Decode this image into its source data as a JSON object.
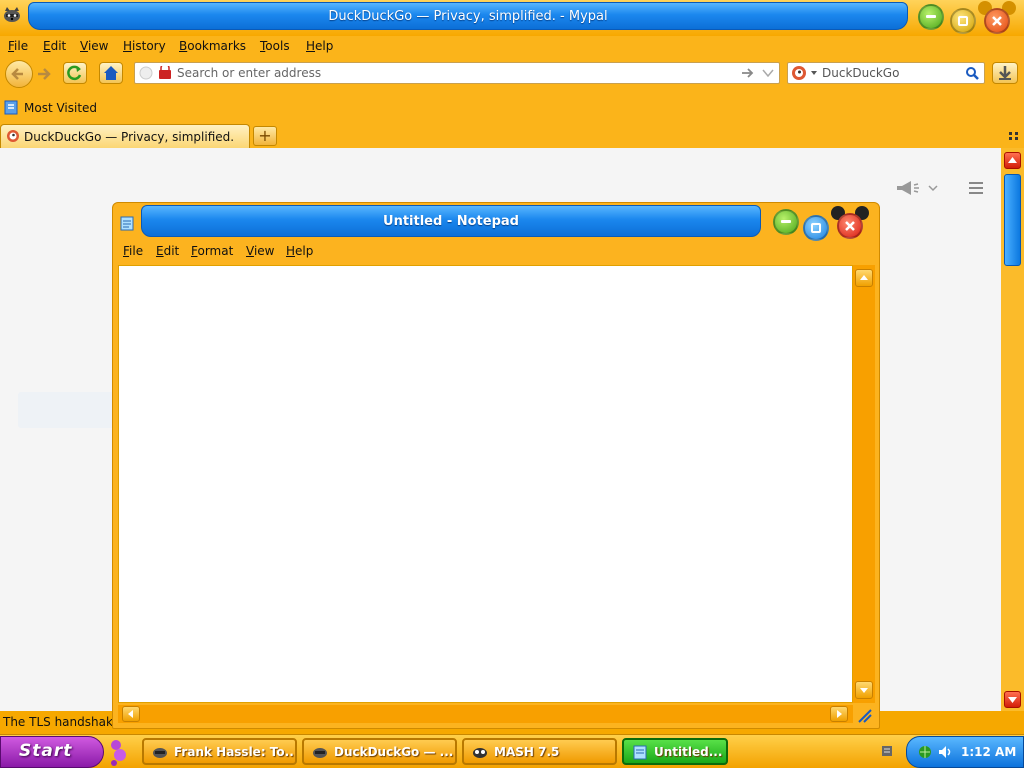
{
  "browser": {
    "title": "DuckDuckGo — Privacy, simplified. - Mypal",
    "menu": [
      "File",
      "Edit",
      "View",
      "History",
      "Bookmarks",
      "Tools",
      "Help"
    ],
    "url_placeholder": "Search or enter address",
    "search_placeholder": "DuckDuckGo",
    "bookmarks": [
      {
        "label": "Most Visited"
      }
    ],
    "tabs": [
      {
        "label": "DuckDuckGo — Privacy, simplified."
      }
    ],
    "new_tab_label": "+",
    "status_text": "The TLS handshake"
  },
  "notepad": {
    "title": "Untitled - Notepad",
    "menu": [
      "File",
      "Edit",
      "Format",
      "View",
      "Help"
    ],
    "content": ""
  },
  "taskbar": {
    "start_label": "Start",
    "items": [
      {
        "label": "Frank Hassle: To..."
      },
      {
        "label": "DuckDuckGo — ..."
      },
      {
        "label": "MASH 7.5"
      },
      {
        "label": "Untitled..."
      }
    ],
    "clock": "1:12 AM"
  },
  "colors": {
    "chrome_orange": "#fbb41a",
    "title_blue": "#1b87ee",
    "start_purple": "#8a1aa8",
    "active_task_green": "#1aa818"
  },
  "icons": [
    "mypal-raccoon-icon",
    "back-arrow-icon",
    "forward-arrow-icon",
    "reload-icon",
    "home-icon",
    "identity-icon",
    "go-arrow-icon",
    "dropdown-icon",
    "duckduckgo-icon",
    "search-icon",
    "download-icon",
    "bookmark-folder-icon",
    "tabs-list-icon",
    "announcement-icon",
    "hamburger-menu-icon",
    "notepad-icon",
    "resize-grip-icon",
    "flower-icon",
    "volume-icon",
    "network-icon"
  ]
}
